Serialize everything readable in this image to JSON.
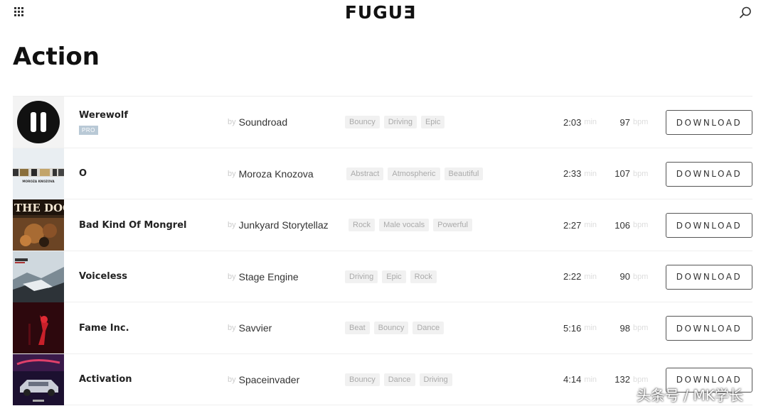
{
  "header": {
    "logo": "FUGUƎ"
  },
  "page": {
    "title": "Action"
  },
  "labels": {
    "by": "by",
    "min": "min",
    "bpm": "bpm",
    "download": "DOWNLOAD"
  },
  "tracks": [
    {
      "title": "Werewolf",
      "badge": "PRO",
      "artist": "Soundroad",
      "tags": [
        "Bouncy",
        "Driving",
        "Epic"
      ],
      "duration": "2:03",
      "bpm": "97"
    },
    {
      "title": "O",
      "artist": "Moroza Knozova",
      "cover_text": "MOROZA KNOZOVA",
      "tags": [
        "Abstract",
        "Atmospheric",
        "Beautiful"
      ],
      "duration": "2:33",
      "bpm": "107"
    },
    {
      "title": "Bad Kind Of Mongrel",
      "artist": "Junkyard Storytellaz",
      "cover_text": "THE DOG",
      "tags": [
        "Rock",
        "Male vocals",
        "Powerful"
      ],
      "duration": "2:27",
      "bpm": "106"
    },
    {
      "title": "Voiceless",
      "artist": "Stage Engine",
      "tags": [
        "Driving",
        "Epic",
        "Rock"
      ],
      "duration": "2:22",
      "bpm": "90"
    },
    {
      "title": "Fame Inc.",
      "artist": "Savvier",
      "tags": [
        "Beat",
        "Bouncy",
        "Dance"
      ],
      "duration": "5:16",
      "bpm": "98"
    },
    {
      "title": "Activation",
      "artist": "Spaceinvader",
      "tags": [
        "Bouncy",
        "Dance",
        "Driving"
      ],
      "duration": "4:14",
      "bpm": "132"
    }
  ],
  "watermark": "头条号 / MK学长",
  "colors": {
    "badge": "#b9c9d6",
    "tag_bg": "#f1f1f1",
    "button_border": "#555555"
  },
  "icons": {
    "menu": "grid-icon",
    "search": "search-icon",
    "pause": "pause-icon"
  }
}
